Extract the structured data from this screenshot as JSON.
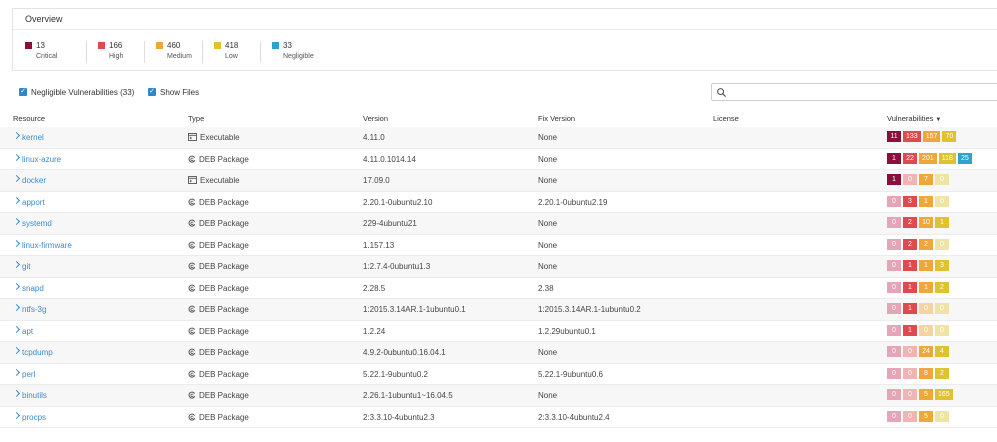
{
  "overview": {
    "title": "Overview",
    "severities": [
      {
        "count": "13",
        "label": "Critical",
        "color": "#8b0f3d"
      },
      {
        "count": "166",
        "label": "High",
        "color": "#e04a4f"
      },
      {
        "count": "460",
        "label": "Medium",
        "color": "#efa73a"
      },
      {
        "count": "418",
        "label": "Low",
        "color": "#dfc22f"
      },
      {
        "count": "33",
        "label": "Negligible",
        "color": "#2aa4cf"
      }
    ]
  },
  "filters": {
    "negligible_label": "Negligible Vulnerabilities (33)",
    "show_files_label": "Show Files",
    "negligible_checked": true,
    "show_files_checked": true
  },
  "search": {
    "placeholder": "",
    "value": ""
  },
  "table": {
    "headers": {
      "resource": "Resource",
      "type": "Type",
      "version": "Version",
      "fix_version": "Fix Version",
      "license": "License",
      "vulnerabilities": "Vulnerabilities"
    },
    "rows": [
      {
        "resource": "kernel",
        "type": "Executable",
        "version": "4.11.0",
        "fix": "None",
        "license": "",
        "vulns": [
          11,
          133,
          157,
          70
        ]
      },
      {
        "resource": "linux-azure",
        "type": "DEB Package",
        "version": "4.11.0.1014.14",
        "fix": "None",
        "license": "",
        "vulns": [
          1,
          22,
          201,
          118,
          25
        ]
      },
      {
        "resource": "docker",
        "type": "Executable",
        "version": "17.09.0",
        "fix": "None",
        "license": "",
        "vulns": [
          1,
          0,
          7,
          0
        ]
      },
      {
        "resource": "apport",
        "type": "DEB Package",
        "version": "2.20.1-0ubuntu2.10",
        "fix": "2.20.1-0ubuntu2.19",
        "license": "",
        "vulns": [
          0,
          3,
          1,
          0
        ]
      },
      {
        "resource": "systemd",
        "type": "DEB Package",
        "version": "229-4ubuntu21",
        "fix": "None",
        "license": "",
        "vulns": [
          0,
          2,
          10,
          1
        ]
      },
      {
        "resource": "linux-firmware",
        "type": "DEB Package",
        "version": "1.157.13",
        "fix": "None",
        "license": "",
        "vulns": [
          0,
          2,
          2,
          0
        ]
      },
      {
        "resource": "git",
        "type": "DEB Package",
        "version": "1:2.7.4-0ubuntu1.3",
        "fix": "None",
        "license": "",
        "vulns": [
          0,
          1,
          1,
          3
        ]
      },
      {
        "resource": "snapd",
        "type": "DEB Package",
        "version": "2.28.5",
        "fix": "2.38",
        "license": "",
        "vulns": [
          0,
          1,
          1,
          2
        ]
      },
      {
        "resource": "ntfs-3g",
        "type": "DEB Package",
        "version": "1:2015.3.14AR.1-1ubuntu0.1",
        "fix": "1:2015.3.14AR.1-1ubuntu0.2",
        "license": "",
        "vulns": [
          0,
          1,
          0,
          0
        ]
      },
      {
        "resource": "apt",
        "type": "DEB Package",
        "version": "1.2.24",
        "fix": "1.2.29ubuntu0.1",
        "license": "",
        "vulns": [
          0,
          1,
          0,
          0
        ]
      },
      {
        "resource": "tcpdump",
        "type": "DEB Package",
        "version": "4.9.2-0ubuntu0.16.04.1",
        "fix": "None",
        "license": "",
        "vulns": [
          0,
          0,
          24,
          4
        ]
      },
      {
        "resource": "perl",
        "type": "DEB Package",
        "version": "5.22.1-9ubuntu0.2",
        "fix": "5.22.1-9ubuntu0.6",
        "license": "",
        "vulns": [
          0,
          0,
          8,
          2
        ]
      },
      {
        "resource": "binutils",
        "type": "DEB Package",
        "version": "2.26.1-1ubuntu1~16.04.5",
        "fix": "None",
        "license": "",
        "vulns": [
          0,
          0,
          5,
          165
        ]
      },
      {
        "resource": "procps",
        "type": "DEB Package",
        "version": "2:3.3.10-4ubuntu2.3",
        "fix": "2:3.3.10-4ubuntu2.4",
        "license": "",
        "vulns": [
          0,
          0,
          5,
          0
        ]
      }
    ]
  },
  "badge_colors": {
    "active": [
      "#8b0f3d",
      "#e04a4f",
      "#efa73a",
      "#dfc22f",
      "#2aa4cf"
    ],
    "faded": [
      "#e6a4b7",
      "#f2b3b4",
      "#f7d3a1",
      "#efe3a6",
      "#a9d8ea"
    ]
  }
}
